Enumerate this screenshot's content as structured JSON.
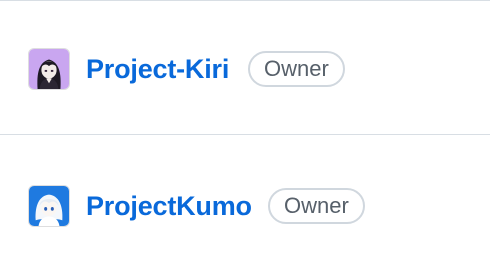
{
  "orgs": [
    {
      "name": "Project-Kiri",
      "role": "Owner",
      "avatar_bg": "#c9a6f0",
      "avatar_icon": "anime-avatar-dark-hair-icon"
    },
    {
      "name": "ProjectKumo",
      "role": "Owner",
      "avatar_bg": "#1f7ae0",
      "avatar_icon": "anime-avatar-white-hair-icon"
    }
  ],
  "colors": {
    "link": "#0969da",
    "badge_border": "#d0d7de",
    "badge_text": "#57606a",
    "divider": "#d8dee4"
  }
}
